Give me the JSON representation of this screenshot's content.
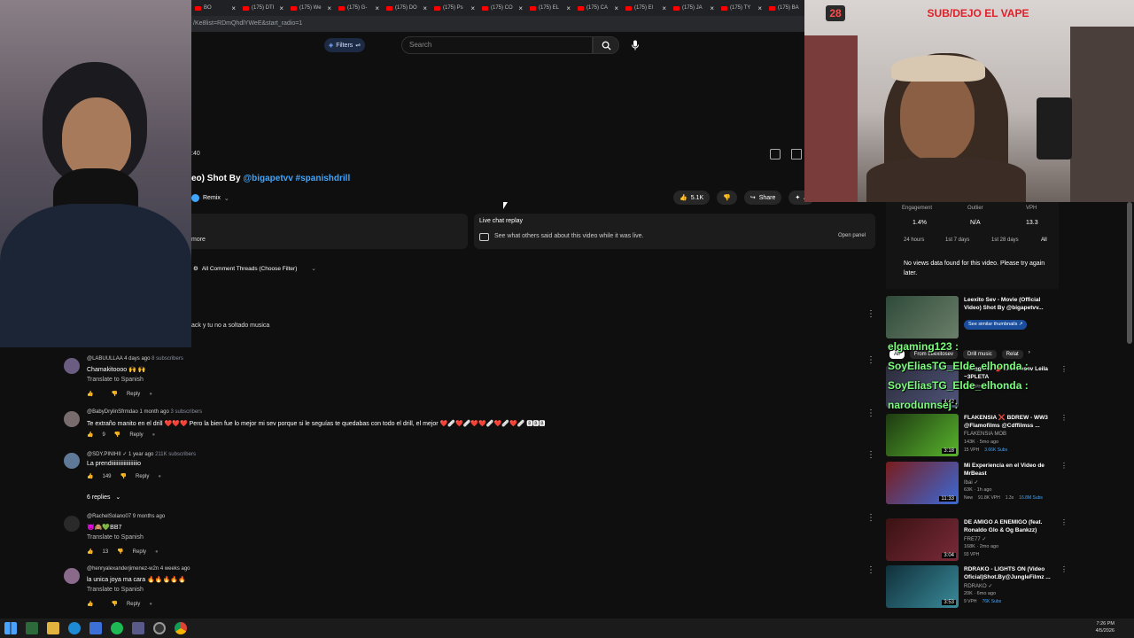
{
  "browser": {
    "tabs": [
      {
        "label": "BO"
      },
      {
        "label": "(175) DTI"
      },
      {
        "label": "(175) We"
      },
      {
        "label": "(175) G-"
      },
      {
        "label": "(175) DO"
      },
      {
        "label": "(175) Ps"
      },
      {
        "label": "(175) CO"
      },
      {
        "label": "(175) EL"
      },
      {
        "label": "(175) CA"
      },
      {
        "label": "(175) El"
      },
      {
        "label": "(175) JA"
      },
      {
        "label": "(175) TY"
      },
      {
        "label": "(175) BA"
      }
    ],
    "url": "/Ke8list=RDmQhdlYWeE&start_radio=1"
  },
  "cam_overlay": {
    "badge": "28",
    "banner": "SUB/DEJO EL VAPE"
  },
  "header": {
    "filters_label": "Filters",
    "search_placeholder": "Search"
  },
  "player": {
    "time": ":40"
  },
  "video": {
    "title_prefix": "eo) Shot By ",
    "title_link": "@bigapetvv #spanishdrill",
    "remix_label": "Remix",
    "likes": "5.1K",
    "share_label": "Share",
    "more_label": "A"
  },
  "description": {
    "more_label": "more"
  },
  "live_chat": {
    "title": "Live chat replay",
    "subtitle": "See what others said about this video while it was live.",
    "open_panel": "Open panel"
  },
  "comments_filter": {
    "label": "All Comment Threads (Choose Filter)"
  },
  "partial_comment": {
    "text": "ack y tu no a soltado musica"
  },
  "comments": [
    {
      "user": "@LABUULLAA",
      "time": "4 days ago",
      "subs": "8 subscribers",
      "text": "Chamakitoooo 🙌 🙌",
      "translate": "Translate to Spanish",
      "likes": "",
      "reply": "Reply"
    },
    {
      "user": "@BabyDrylinSfrmdao",
      "time": "1 month ago",
      "subs": "3 subscribers",
      "text": "Te extraño manito en el drill ❤️❤️❤️ Pero la bien fue lo mejor mi sev porque si le seguías te quedabas con todo el drill, el mejor ❤️🩹❤️🩹❤️❤️🩹❤️🩹❤️🩹 🅱🅱🅱",
      "translate": "",
      "likes": "9",
      "reply": "Reply"
    },
    {
      "user": "@SDY.PINIHII ✓",
      "time": "1 year ago",
      "subs": "211K subscribers",
      "text": "La prendiiiiiiiiiiiiiiiiiiio",
      "translate": "",
      "likes": "149",
      "reply": "Reply"
    },
    {
      "user": "@RachelSolano07",
      "time": "9 months ago",
      "subs": "",
      "text": "😈🙈💚BB7",
      "translate": "Translate to Spanish",
      "likes": "13",
      "reply": "Reply"
    },
    {
      "user": "@henryalexanderjimenez-w2n",
      "time": "4 weeks ago",
      "subs": "",
      "text": "la unica joya ma cara 🔥🔥🔥🔥🔥",
      "translate": "Translate to Spanish",
      "likes": "",
      "reply": "Reply"
    }
  ],
  "replies_toggle": "6 replies",
  "stats": {
    "headers": [
      "Engagement",
      "Outlier",
      "VPH"
    ],
    "values": [
      "1.4%",
      "N/A",
      "13.3"
    ],
    "ranges": [
      "24 hours",
      "1st 7 days",
      "1st 28 days",
      "All"
    ],
    "message": "No views data found for this video. Please try again later."
  },
  "similar_button": "See similar thumbnails ↗",
  "chips": [
    "All",
    "From Leexitosev",
    "Drill music",
    "Relat"
  ],
  "suggested": [
    {
      "title": "Leexito Sev - Movie (Official Video) Shot By @bigapetvv...",
      "channel": "",
      "meta": "",
      "tags": [],
      "duration": ""
    },
    {
      "title": "Young Ave 🔴 Leexitosev Leila ~3PLETA",
      "channel": "",
      "meta": "",
      "tags": [
        "104 VPH",
        "40.4K Subs"
      ],
      "duration": "4:42"
    },
    {
      "title": "FLAKENSIA ❌ BDREW - WW3 @Flamofilms @Cdffilmss ...",
      "channel": "FLAKENSIA MOB",
      "meta": "143K · 5mo ago",
      "tags": [
        "15 VPH",
        "3.66K Subs"
      ],
      "duration": "3:18"
    },
    {
      "title": "Mi Experiencia en el Video de MrBeast",
      "channel": "Ibai ✓",
      "meta": "63K · 1h ago",
      "tags": [
        "New",
        "91.8K VPH",
        "1.3x",
        "16.8M Subs"
      ],
      "duration": "11:33"
    },
    {
      "title": "DE AMIGO A ENEMIGO (feat. Ronaldo Glo & Og Bankzz)",
      "channel": "FRE77 ✓",
      "meta": "168K · 2mo ago",
      "tags": [
        "93 VPH"
      ],
      "duration": "3:04"
    },
    {
      "title": "RDRAKO - LIGHTS ON (Video Oficial)Shot.By@JungleFilmz ...",
      "channel": "RDRAKO ✓",
      "meta": "20K · 6mo ago",
      "tags": [
        "9 VPH",
        "76K Subs"
      ],
      "duration": "3:53"
    }
  ],
  "chat_overlay": [
    {
      "text": "elgaming123 :"
    },
    {
      "text": "SoyEliasTG_Elde_elhonda :"
    },
    {
      "text": "SoyEliasTG_Elde_elhonda :"
    },
    {
      "text": "narodunnsej :"
    }
  ],
  "clock": {
    "time": "7:26 PM",
    "date": "4/5/2026"
  }
}
